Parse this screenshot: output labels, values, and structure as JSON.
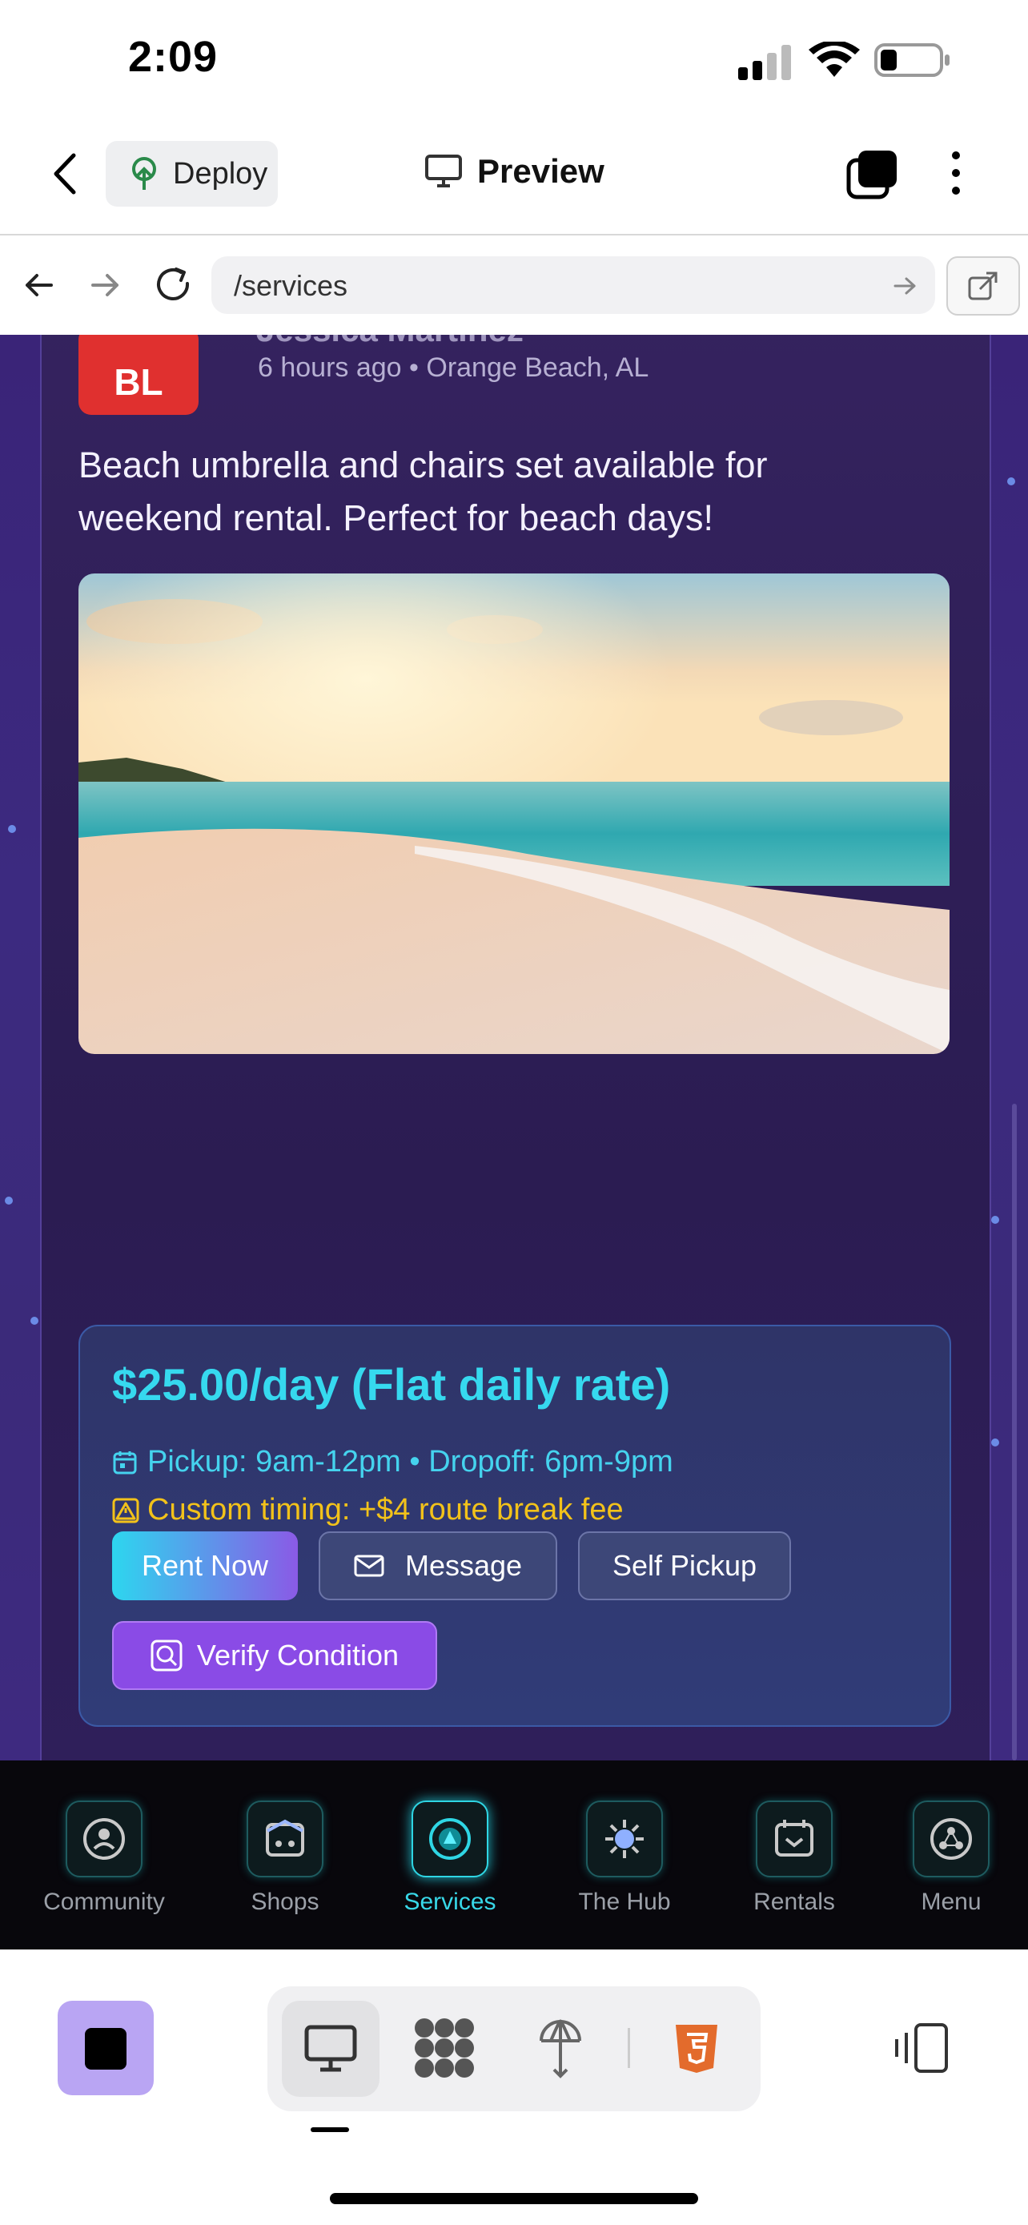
{
  "status_bar": {
    "time": "2:09"
  },
  "top_nav": {
    "deploy_label": "Deploy",
    "preview_label": "Preview"
  },
  "address_bar": {
    "url": "/services"
  },
  "post": {
    "avatar_initials": "BL",
    "user_name": "Jessica Martinez",
    "meta": "6 hours ago • Orange Beach, AL",
    "text": "Beach umbrella and chairs set available for weekend rental. Perfect for beach days!",
    "price": "$25.00/day (Flat daily rate)",
    "schedule": "Pickup: 9am-12pm • Dropoff: 6pm-9pm",
    "custom_timing": "Custom timing: +$4 route break fee",
    "buttons": {
      "rent": "Rent Now",
      "message": "Message",
      "self_pickup": "Self Pickup",
      "verify": "Verify Condition"
    }
  },
  "app_nav": {
    "items": [
      {
        "label": "Community"
      },
      {
        "label": "Shops"
      },
      {
        "label": "Services",
        "active": true
      },
      {
        "label": "The Hub"
      },
      {
        "label": "Rentals"
      },
      {
        "label": "Menu"
      }
    ]
  },
  "colors": {
    "accent": "#38d8e8",
    "price": "#36d9ef",
    "warning": "#f2c21a",
    "verify": "#8a4be6"
  }
}
